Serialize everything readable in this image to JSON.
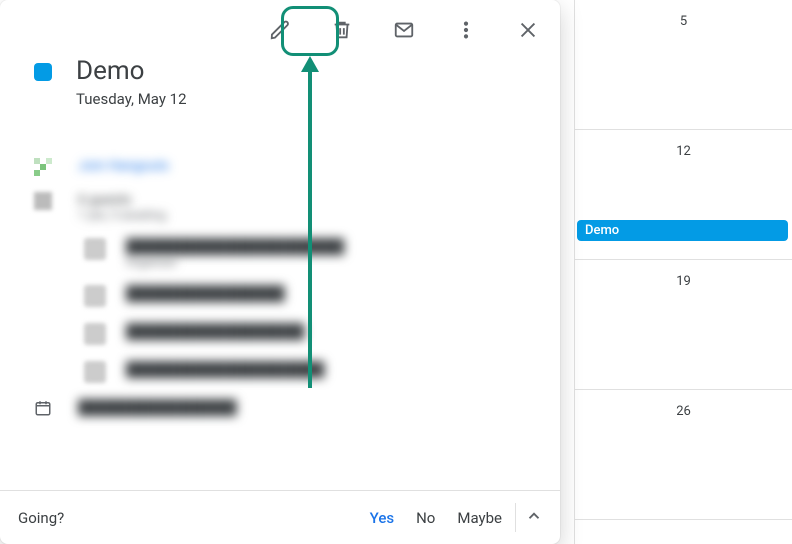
{
  "colors": {
    "accent": "#1a73e8",
    "event_chip": "#039be5",
    "event_square": "#039be5",
    "highlight": "#128f76"
  },
  "toolbar": {
    "edit": "Edit event",
    "delete": "Delete event",
    "email": "Email guests",
    "options": "Options",
    "close": "Close"
  },
  "event": {
    "title": "Demo",
    "date": "Tuesday, May 12",
    "hangout_link": "Join Hangouts",
    "guest_summary": "6 guests",
    "guest_sub": "1 yes, 5 awaiting",
    "guests": [
      {
        "name": "██████████████████████",
        "sub": "Organizer"
      },
      {
        "name": "████████████████"
      },
      {
        "name": "██████████████████"
      },
      {
        "name": "████████████████████"
      }
    ],
    "calendar_label": "████████████████"
  },
  "rsvp": {
    "prompt": "Going?",
    "yes": "Yes",
    "no": "No",
    "maybe": "Maybe"
  },
  "grid": {
    "dates": [
      "5",
      "12",
      "19",
      "26"
    ],
    "event_label": "Demo"
  }
}
